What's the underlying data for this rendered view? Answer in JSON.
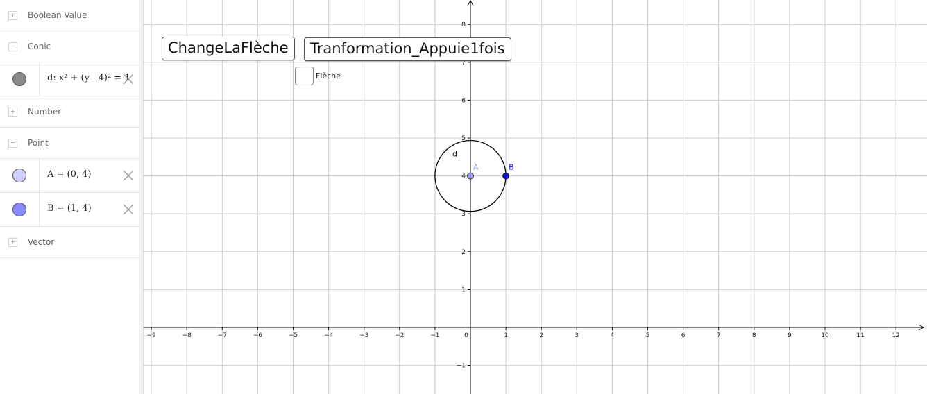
{
  "algebra": {
    "groups": [
      {
        "name": "Boolean Value",
        "toggle": "+"
      },
      {
        "name": "Conic",
        "toggle": "−"
      },
      {
        "name": "Number",
        "toggle": "+"
      },
      {
        "name": "Point",
        "toggle": "−"
      },
      {
        "name": "Vector",
        "toggle": "+"
      }
    ],
    "items": {
      "conic_d": {
        "text": "d: x² + (y - 4)² = 1",
        "color": "#8a8a8a"
      },
      "point_A": {
        "text": "A = (0, 4)",
        "color": "#cfcfff"
      },
      "point_B": {
        "text": "B = (1, 4)",
        "color": "#8a8aff"
      }
    }
  },
  "graphics": {
    "buttons": {
      "change": "ChangeLaFlèche",
      "transform": "Tranformation_Appuie1fois"
    },
    "checkbox": {
      "label": "Flèche",
      "checked": false
    },
    "axes": {
      "xlim": [
        -9,
        12
      ],
      "ylim": [
        -1,
        8
      ],
      "x_ticks": [
        "−9",
        "−8",
        "−7",
        "−6",
        "−5",
        "−4",
        "−3",
        "−2",
        "−1",
        "0",
        "1",
        "2",
        "3",
        "4",
        "5",
        "6",
        "7",
        "8",
        "9",
        "10",
        "11",
        "12"
      ],
      "y_ticks": [
        "−1",
        "1",
        "2",
        "3",
        "4",
        "5",
        "6",
        "7",
        "8"
      ],
      "grid": true
    },
    "objects": {
      "circle_d": {
        "label": "d",
        "center": [
          0,
          4
        ],
        "radius": 1,
        "color": "#000000"
      },
      "point_A": {
        "label": "A",
        "x": 0,
        "y": 4,
        "color": "#9a9aef"
      },
      "point_B": {
        "label": "B",
        "x": 1,
        "y": 4,
        "color": "#1010c8"
      }
    }
  }
}
